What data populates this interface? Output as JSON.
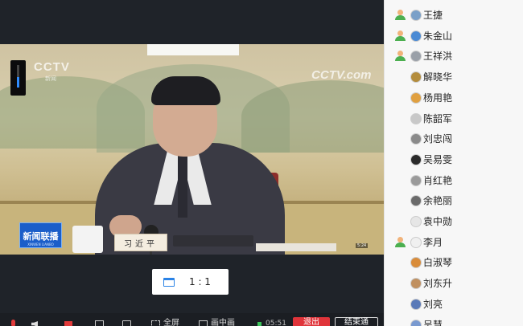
{
  "video": {
    "top_caption": [
      "",
      "",
      ""
    ],
    "cctv_left": "CCTV",
    "cctv_left_sub": "新闻",
    "cctv_right": "CCTV.com",
    "news_logo_title": "新闻联播",
    "news_logo_sub": "XINWEN LIANBO",
    "nameplate": "习近平",
    "timestamp": "5:24",
    "volume_level": 0.45
  },
  "ratio_button": {
    "label": "1 : 1"
  },
  "toolbar": {
    "fullscreen_label": "全屏",
    "pip_label": "画中画",
    "time": "05:51",
    "leave_label": "退出",
    "end_label": "结束通"
  },
  "participants": [
    {
      "name": "王捷",
      "role_icon": true,
      "avatar_color": "#7aa0c8"
    },
    {
      "name": "朱金山",
      "role_icon": true,
      "avatar_color": "#4a8ad4"
    },
    {
      "name": "王祥洪",
      "role_icon": true,
      "avatar_color": "#9aa0a8"
    },
    {
      "name": "解晓华",
      "role_icon": false,
      "avatar_color": "#b38c3c"
    },
    {
      "name": "杨用艳",
      "role_icon": false,
      "avatar_color": "#e0a040"
    },
    {
      "name": "陈韶军",
      "role_icon": false,
      "avatar_color": "#c8c8c8"
    },
    {
      "name": "刘忠闯",
      "role_icon": false,
      "avatar_color": "#8a8a8a"
    },
    {
      "name": "吴易雯",
      "role_icon": false,
      "avatar_color": "#2a2a2a"
    },
    {
      "name": "肖红艳",
      "role_icon": false,
      "avatar_color": "#9a9a9a"
    },
    {
      "name": "余艳丽",
      "role_icon": false,
      "avatar_color": "#6a6a6a"
    },
    {
      "name": "袁中勋",
      "role_icon": false,
      "avatar_color": "#e6e6e6"
    },
    {
      "name": "李月",
      "role_icon": true,
      "avatar_color": "#f0f0f0"
    },
    {
      "name": "白淑琴",
      "role_icon": false,
      "avatar_color": "#d98c3a"
    },
    {
      "name": "刘东升",
      "role_icon": false,
      "avatar_color": "#c09060"
    },
    {
      "name": "刘亮",
      "role_icon": false,
      "avatar_color": "#5a7ab8"
    },
    {
      "name": "吴慧",
      "role_icon": false,
      "avatar_color": "#7a9ad0"
    }
  ]
}
